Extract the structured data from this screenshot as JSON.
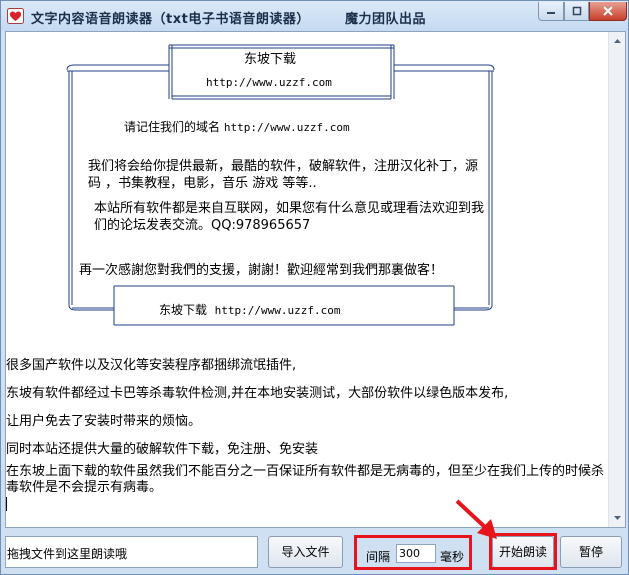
{
  "window": {
    "title": "文字内容语音朗读器（txt电子书语音朗读器）       魔力团队出品"
  },
  "banner": {
    "site_name": "东坡下载",
    "url": "http://www.uzzf.com",
    "remember_label": "请记住我们的域名",
    "remember_url": "http://www.uzzf.com",
    "paragraph1": "我们将会给你提供最新，最酷的软件，破解软件，注册汉化补丁，源码 ，书集教程，电影，音乐 游戏 等等..",
    "paragraph2": "本站所有软件都是来自互联网，如果您有什么意见或理看法欢迎到我们的论坛发表交流。QQ:978965657",
    "thanks": "再一次感謝您對我們的支援，謝謝！歡迎經常到我們那裏做客！",
    "bottom_site": "东坡下载",
    "bottom_url": "http://www.uzzf.com"
  },
  "body_text": {
    "line1": "很多国产软件以及汉化等安装程序都捆绑流氓插件,",
    "line2": "东坡有软件都经过卡巴等杀毒软件检测,并在本地安装测试，大部份软件以绿色版本发布,",
    "line3": "让用户免去了安装时带来的烦恼。",
    "line4": "同时本站还提供大量的破解软件下载，免注册、免安装",
    "line5": "在东坡上面下载的软件虽然我们不能百分之一百保证所有软件都是无病毒的，但至少在我们上传的时候杀毒软件是不会提示有病毒。"
  },
  "toolbar": {
    "drop_hint": "拖拽文件到这里朗读哦",
    "import_label": "导入文件",
    "interval_label": "间隔",
    "interval_value": "300",
    "interval_unit": "毫秒",
    "start_label": "开始朗读",
    "pause_label": "暂停"
  },
  "colors": {
    "annotation": "#e8141b",
    "title_bar": "#c5daf1"
  },
  "icons": {
    "app": "heart-icon",
    "minimize": "minimize-icon",
    "maximize": "maximize-icon",
    "close": "close-icon"
  }
}
